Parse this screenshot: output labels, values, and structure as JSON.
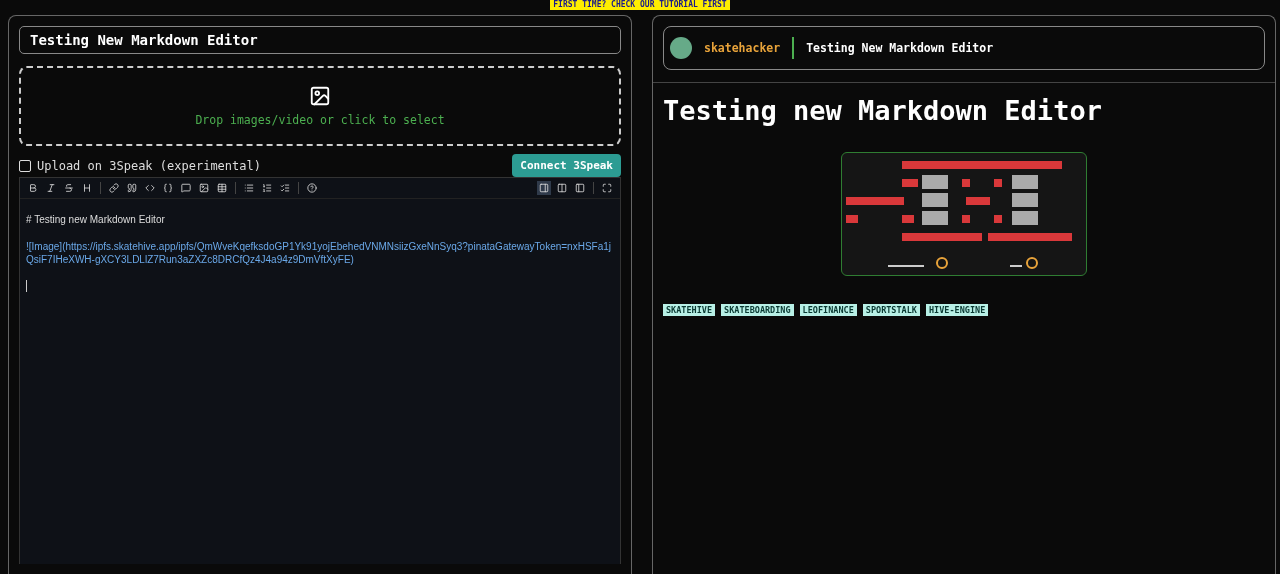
{
  "banner": "FIRST TIME? CHECK OUR TUTORIAL FIRST",
  "editor": {
    "title_value": "Testing New Markdown Editor",
    "dropzone": "Drop images/video or click to select",
    "upload_option": {
      "label": "Upload on 3Speak (experimental)",
      "checked": false
    },
    "connect_button": "Connect 3Speak",
    "view_modes": [
      {
        "selected": true
      },
      {
        "selected": false
      },
      {
        "selected": false
      }
    ],
    "lines": [
      {
        "kind": "heading",
        "text": "# Testing new Markdown Editor"
      },
      {
        "kind": "link",
        "text": "![Image](https://ipfs.skatehive.app/ipfs/QmWveKqefksdoGP1Yk91yojEbehedVNMNsiizGxeNnSyq3?pinataGatewayToken=nxHSFa1jQsiF7IHeXWH-gXCY3LDLlZ7Run3aZXZc8DRCfQz4J4a94z9DmVftXyFE)"
      },
      {
        "kind": "cursor"
      }
    ]
  },
  "preview": {
    "author": "skatehacker",
    "title": "Testing New Markdown Editor",
    "heading": "Testing new Markdown Editor",
    "tags": [
      "SKATEHIVE",
      "SKATEBOARDING",
      "LEOFINANCE",
      "SPORTSTALK",
      "HIVE-ENGINE"
    ]
  }
}
